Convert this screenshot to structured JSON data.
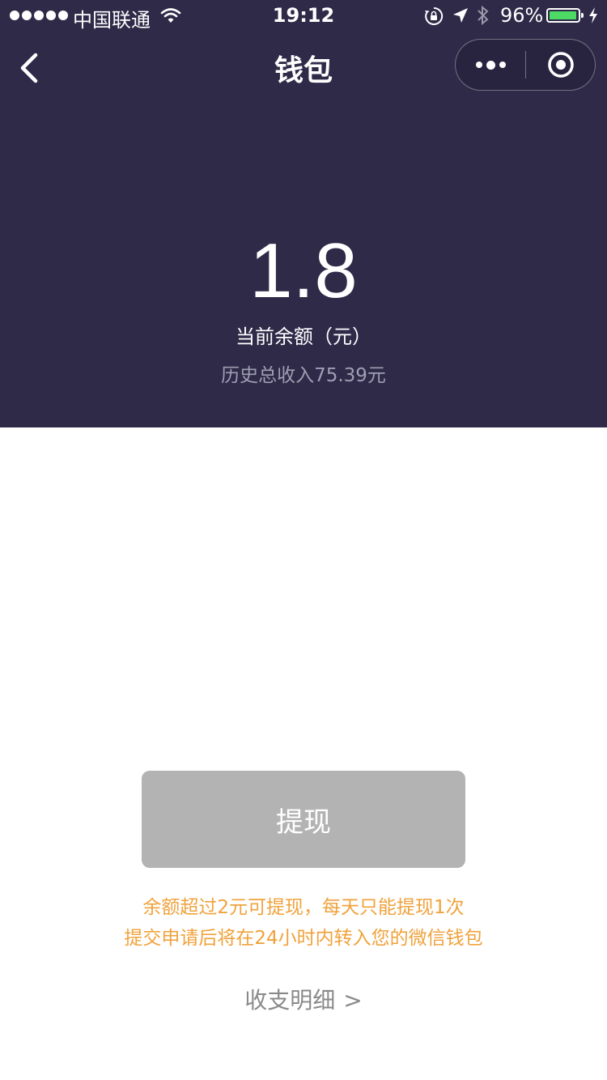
{
  "status_bar": {
    "carrier": "中国联通",
    "time": "19:12",
    "battery_percent": "96%",
    "battery_level": 0.96,
    "icons": [
      "signal-dots-icon",
      "wifi-icon",
      "orientation-lock-icon",
      "location-arrow-icon",
      "bluetooth-icon",
      "battery-icon",
      "charging-bolt-icon"
    ]
  },
  "nav": {
    "title": "钱包",
    "icons": [
      "back-chevron-icon",
      "more-dots-icon",
      "close-target-icon"
    ]
  },
  "wallet": {
    "balance": "1.8",
    "balance_label": "当前余额（元）",
    "total_income": "历史总收入75.39元"
  },
  "actions": {
    "withdraw_label": "提现",
    "notice_line1": "余额超过2元可提现，每天只能提现1次",
    "notice_line2": "提交申请后将在24小时内转入您的微信钱包",
    "detail_label": "收支明细",
    "detail_arrow": ">"
  },
  "colors": {
    "header_bg": "#2e2a48",
    "button_bg": "#b3b3b3",
    "notice_text": "#f0a23c",
    "battery_fill": "#4cd964"
  }
}
